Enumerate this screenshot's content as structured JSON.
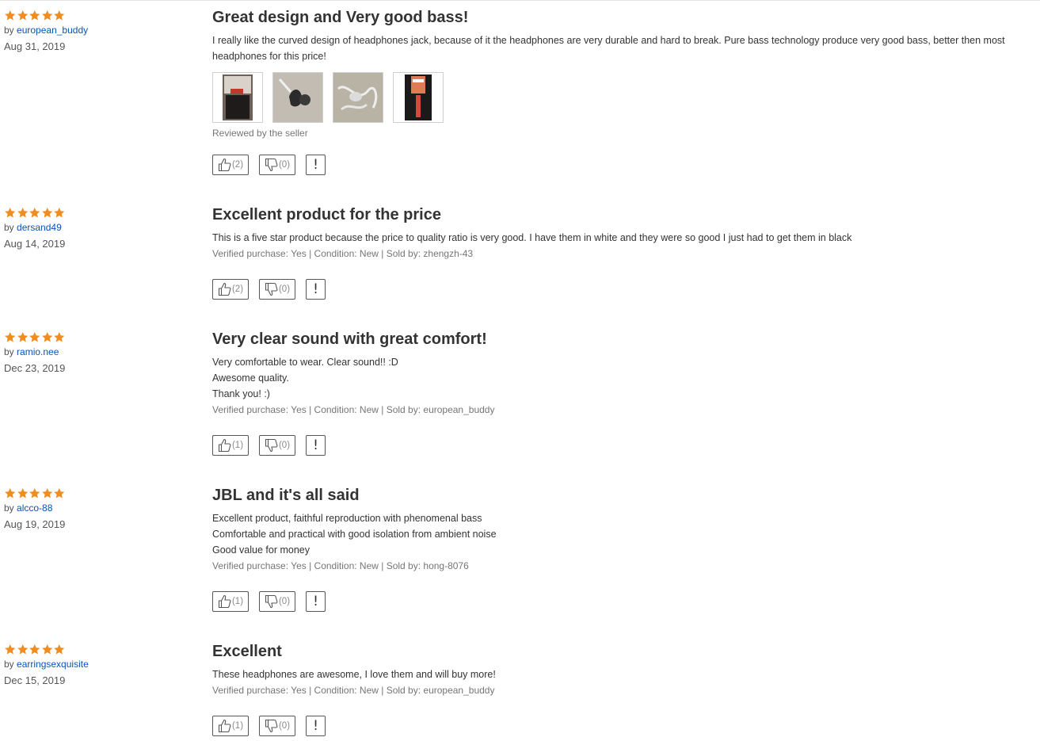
{
  "colors": {
    "star": "#f18c1f",
    "username_link": "#0654ba",
    "muted_text": "#767676"
  },
  "reviews": [
    {
      "rating": 5,
      "by_prefix": "by",
      "username": "european_buddy",
      "date": "Aug 31, 2019",
      "title": "Great design and Very good bass!",
      "body": [
        "I really like the curved design of headphones jack, because of it the headphones are very durable and hard to break. Pure bass technology produce very good bass, better then most headphones for this price!"
      ],
      "photos": [
        "product-photo-box",
        "product-photo-earbuds",
        "product-photo-cable",
        "product-photo-package"
      ],
      "note": "Reviewed by the seller",
      "helpful": "(2)",
      "unhelpful": "(0)",
      "flag": "!"
    },
    {
      "rating": 5,
      "by_prefix": "by",
      "username": "dersand49",
      "date": "Aug 14, 2019",
      "title": "Excellent product for the price",
      "body": [
        "This is a five star product because the price to quality ratio is very good. I have them in white and they were so good I just had to get them in black"
      ],
      "note": "Verified purchase: Yes | Condition: New | Sold by: zhengzh-43",
      "helpful": "(2)",
      "unhelpful": "(0)",
      "flag": "!"
    },
    {
      "rating": 5,
      "by_prefix": "by",
      "username": "ramio.nee",
      "date": "Dec 23, 2019",
      "title": "Very clear sound with great comfort!",
      "body": [
        "Very comfortable to wear. Clear sound!! :D",
        "Awesome quality.",
        "Thank you! :)"
      ],
      "note": "Verified purchase: Yes | Condition: New | Sold by: european_buddy",
      "helpful": "(1)",
      "unhelpful": "(0)",
      "flag": "!"
    },
    {
      "rating": 5,
      "by_prefix": "by",
      "username": "alcco-88",
      "date": "Aug 19, 2019",
      "title": "JBL and it's all said",
      "body": [
        "Excellent product, faithful reproduction with phenomenal bass",
        "Comfortable and practical with good isolation from ambient noise",
        "Good value for money"
      ],
      "note": "Verified purchase: Yes | Condition: New | Sold by: hong-8076",
      "helpful": "(1)",
      "unhelpful": "(0)",
      "flag": "!"
    },
    {
      "rating": 5,
      "by_prefix": "by",
      "username": "earringsexquisite",
      "date": "Dec 15, 2019",
      "title": "Excellent",
      "body": [
        "These headphones are awesome, I love them and will buy more!"
      ],
      "note": "Verified purchase: Yes | Condition: New | Sold by: european_buddy",
      "helpful": "(1)",
      "unhelpful": "(0)",
      "flag": "!"
    }
  ]
}
